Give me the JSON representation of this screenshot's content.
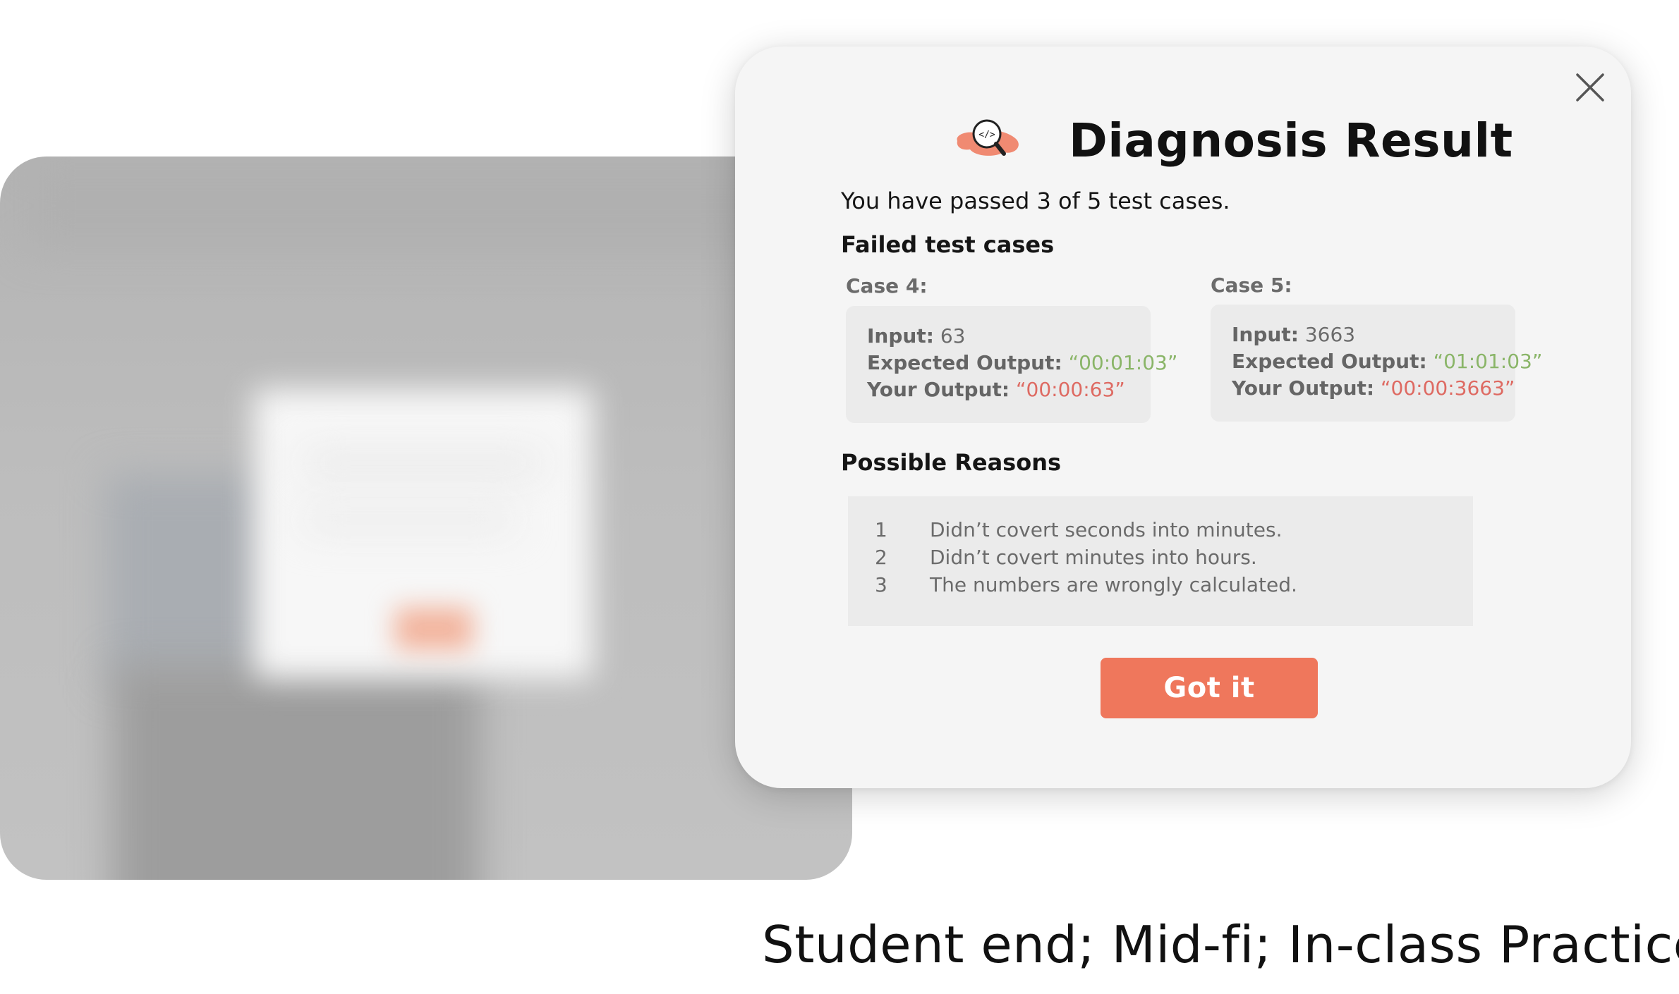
{
  "dialog": {
    "title": "Diagnosis Result",
    "icon": "magnifier-code-icon",
    "close_icon": "close-icon",
    "summary": "You have passed 3 of 5 test cases.",
    "failed_title": "Failed test cases",
    "cases": [
      {
        "label": "Case 4:",
        "input_key": "Input:",
        "input_value": "63",
        "expected_key": "Expected Output:",
        "expected_value": "“00:01:03”",
        "yours_key": "Your Output:",
        "yours_value": "“00:00:63”"
      },
      {
        "label": "Case 5:",
        "input_key": "Input:",
        "input_value": "3663",
        "expected_key": "Expected Output:",
        "expected_value": "“01:01:03”",
        "yours_key": "Your Output:",
        "yours_value": "“00:00:3663”"
      }
    ],
    "reasons_title": "Possible Reasons",
    "reasons": [
      {
        "num": "1",
        "text": "Didn’t covert seconds into minutes."
      },
      {
        "num": "2",
        "text": "Didn’t covert minutes into hours."
      },
      {
        "num": "3",
        "text": "The numbers are wrongly calculated."
      }
    ],
    "button_label": "Got it"
  },
  "caption": "Student end; Mid-fi; In-class Practice",
  "colors": {
    "accent": "#ef775c",
    "expected_green": "#8ab568",
    "output_red": "#de6a62",
    "dialog_bg": "#f5f5f5"
  }
}
